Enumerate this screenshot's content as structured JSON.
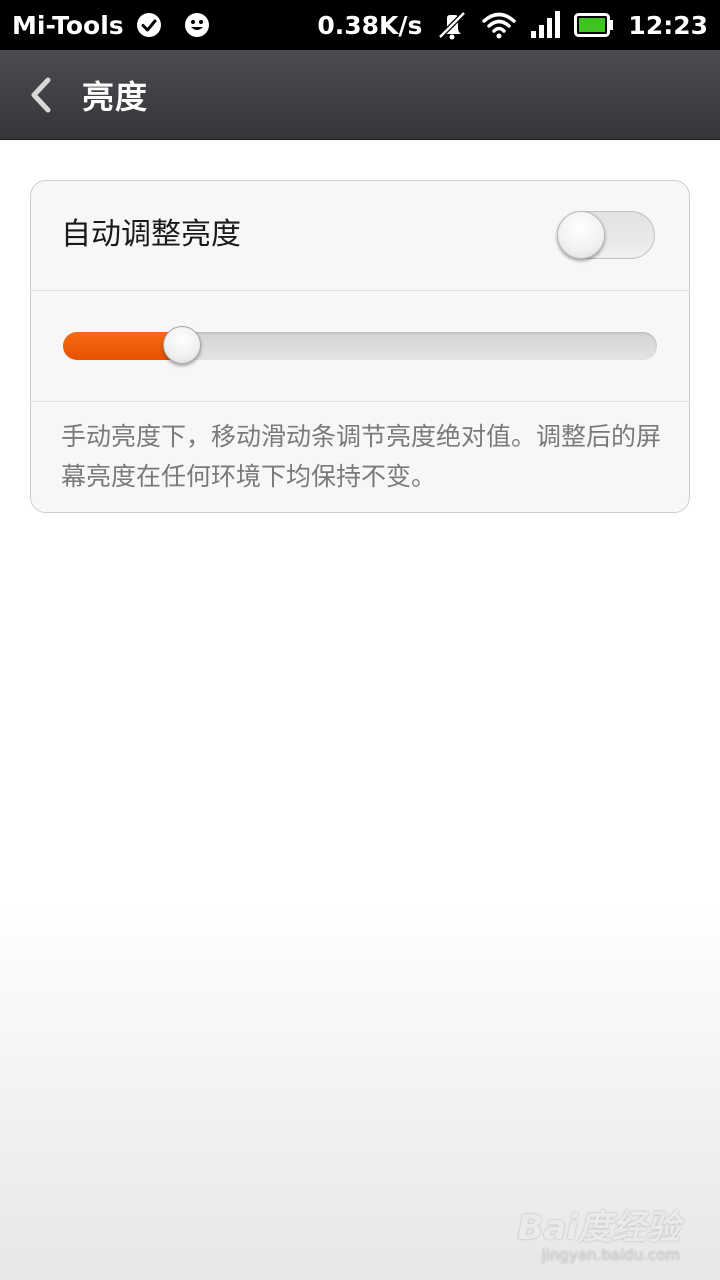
{
  "status_bar": {
    "app_name": "Mi-Tools",
    "network_speed": "0.38K/s",
    "time": "12:23",
    "icons": [
      "check-circle-icon",
      "smiley-icon",
      "vibrate-off-icon",
      "wifi-icon",
      "signal-icon",
      "battery-icon"
    ],
    "battery_color": "#3ec31f"
  },
  "title_bar": {
    "title": "亮度"
  },
  "settings": {
    "auto_brightness_label": "自动调整亮度",
    "auto_brightness_enabled": false,
    "brightness_level": 0.2,
    "description": "手动亮度下，移动滑动条调节亮度绝对值。调整后的屏幕亮度在任何环境下均保持不变。"
  },
  "colors": {
    "accent": "#f0620c",
    "title_bar": "#3d3f43"
  },
  "watermark": {
    "brand": "Bai度经验",
    "url": "jingyan.baidu.com"
  }
}
